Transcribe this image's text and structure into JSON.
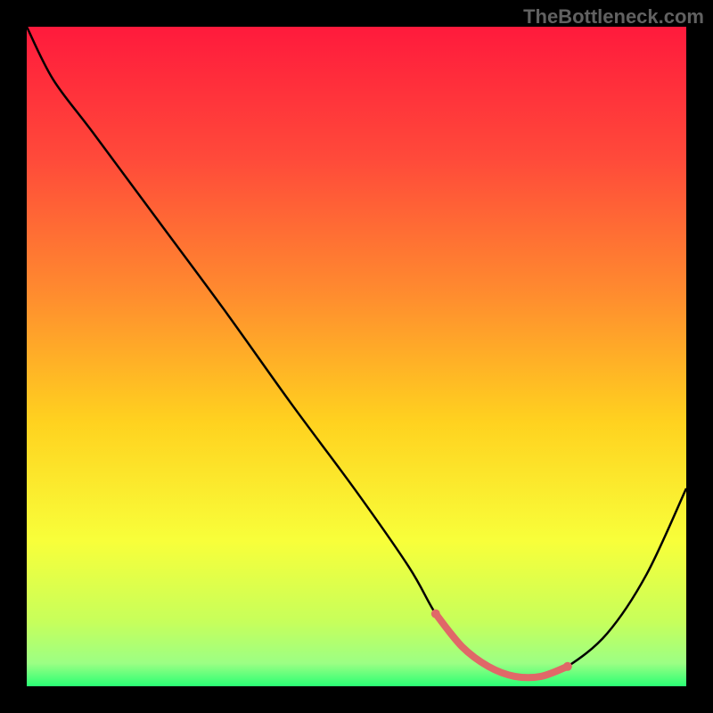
{
  "watermark": "TheBottleneck.com",
  "chart_data": {
    "type": "line",
    "title": "",
    "xlabel": "",
    "ylabel": "",
    "xlim": [
      0,
      100
    ],
    "ylim": [
      0,
      100
    ],
    "series": [
      {
        "name": "bottleneck-curve",
        "x": [
          0,
          4,
          10,
          20,
          30,
          40,
          50,
          58,
          62,
          66,
          70,
          74,
          78,
          82,
          88,
          94,
          100
        ],
        "y": [
          100,
          92,
          84,
          70.5,
          57,
          43,
          29.5,
          18,
          11,
          6,
          3,
          1.5,
          1.5,
          3,
          8,
          17,
          30
        ]
      },
      {
        "name": "bottleneck-highlight",
        "x": [
          62,
          66,
          70,
          74,
          78,
          82
        ],
        "y": [
          11,
          6,
          3,
          1.5,
          1.5,
          3
        ]
      }
    ],
    "gradient_stops": [
      {
        "offset": 0.0,
        "color": "#ff1a3c"
      },
      {
        "offset": 0.2,
        "color": "#ff4a3a"
      },
      {
        "offset": 0.4,
        "color": "#ff8a2f"
      },
      {
        "offset": 0.6,
        "color": "#ffd21f"
      },
      {
        "offset": 0.78,
        "color": "#f8ff3a"
      },
      {
        "offset": 0.9,
        "color": "#c8ff5a"
      },
      {
        "offset": 0.965,
        "color": "#9cff84"
      },
      {
        "offset": 1.0,
        "color": "#2aff74"
      }
    ],
    "curve_color": "#000000",
    "highlight_color": "#e06868",
    "plot_bg": "gradient"
  }
}
